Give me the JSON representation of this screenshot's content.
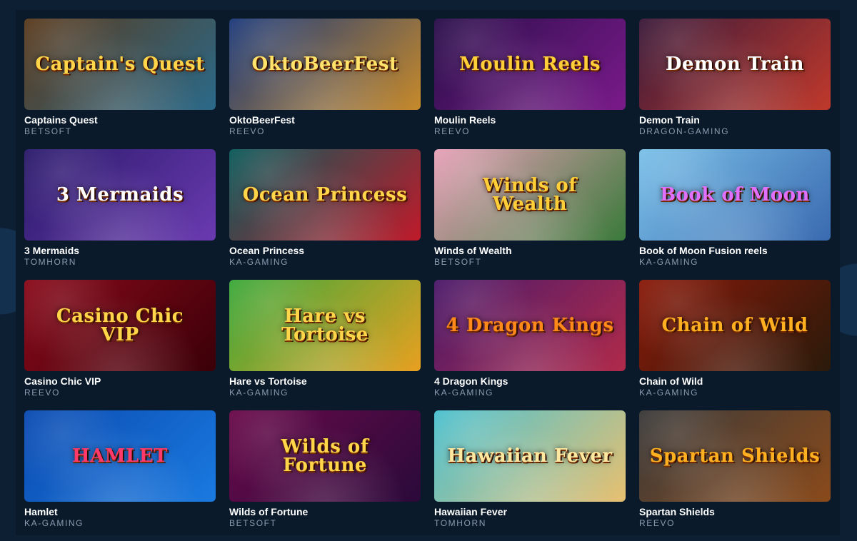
{
  "games": [
    {
      "title": "Captains Quest",
      "provider": "BETSOFT",
      "logo": "Captain's Quest",
      "bg1": "#5a3a1c",
      "bg2": "#2a6a8a",
      "logo_color": "#ffd54a"
    },
    {
      "title": "OktoBeerFest",
      "provider": "REEVO",
      "logo": "OktoBeerFest",
      "bg1": "#1c3a7a",
      "bg2": "#c78a2a",
      "logo_color": "#ffe36a"
    },
    {
      "title": "Moulin Reels",
      "provider": "REEVO",
      "logo": "Moulin Reels",
      "bg1": "#2a0f4a",
      "bg2": "#7a1a8a",
      "logo_color": "#ffcf3a"
    },
    {
      "title": "Demon Train",
      "provider": "DRAGON-GAMING",
      "logo": "Demon Train",
      "bg1": "#3a1a3a",
      "bg2": "#c0392b",
      "logo_color": "#ffffff"
    },
    {
      "title": "3 Mermaids",
      "provider": "TOMHORN",
      "logo": "3 Mermaids",
      "bg1": "#2a1a6a",
      "bg2": "#6a3ab0",
      "logo_color": "#ffffff"
    },
    {
      "title": "Ocean Princess",
      "provider": "KA-GAMING",
      "logo": "Ocean Princess",
      "bg1": "#0a5a5a",
      "bg2": "#c01a2a",
      "logo_color": "#ffd54a"
    },
    {
      "title": "Winds of Wealth",
      "provider": "BETSOFT",
      "logo": "Winds of Wealth",
      "bg1": "#e8a0b8",
      "bg2": "#3a7a3a",
      "logo_color": "#ffcf3a"
    },
    {
      "title": "Book of Moon Fusion reels",
      "provider": "KA-GAMING",
      "logo": "Book of Moon",
      "bg1": "#7ac0e8",
      "bg2": "#3a6ab0",
      "logo_color": "#e070ff"
    },
    {
      "title": "Casino Chic VIP",
      "provider": "REEVO",
      "logo": "Casino Chic VIP",
      "bg1": "#8a0a1a",
      "bg2": "#3a0008",
      "logo_color": "#ffd54a"
    },
    {
      "title": "Hare vs Tortoise",
      "provider": "KA-GAMING",
      "logo": "Hare vs Tortoise",
      "bg1": "#3aa83a",
      "bg2": "#e8a020",
      "logo_color": "#ffd54a"
    },
    {
      "title": "4 Dragon Kings",
      "provider": "KA-GAMING",
      "logo": "4 Dragon Kings",
      "bg1": "#4a1a6a",
      "bg2": "#b02a4a",
      "logo_color": "#ff8a1a"
    },
    {
      "title": "Chain of Wild",
      "provider": "KA-GAMING",
      "logo": "Chain of Wild",
      "bg1": "#8a1a0a",
      "bg2": "#2a1a0a",
      "logo_color": "#ffb020"
    },
    {
      "title": "Hamlet",
      "provider": "KA-GAMING",
      "logo": "HAMLET",
      "bg1": "#0a4ab0",
      "bg2": "#1a7ae0",
      "logo_color": "#ff3a6a"
    },
    {
      "title": "Wilds of Fortune",
      "provider": "BETSOFT",
      "logo": "Wilds of Fortune",
      "bg1": "#6a0a4a",
      "bg2": "#2a0a3a",
      "logo_color": "#ffd54a"
    },
    {
      "title": "Hawaiian Fever",
      "provider": "TOMHORN",
      "logo": "Hawaiian Fever",
      "bg1": "#4ac0d0",
      "bg2": "#e8c070",
      "logo_color": "#ffe9a0"
    },
    {
      "title": "Spartan Shields",
      "provider": "REEVO",
      "logo": "Spartan Shields",
      "bg1": "#3a3a3a",
      "bg2": "#8a4a1a",
      "logo_color": "#ffb020"
    }
  ]
}
